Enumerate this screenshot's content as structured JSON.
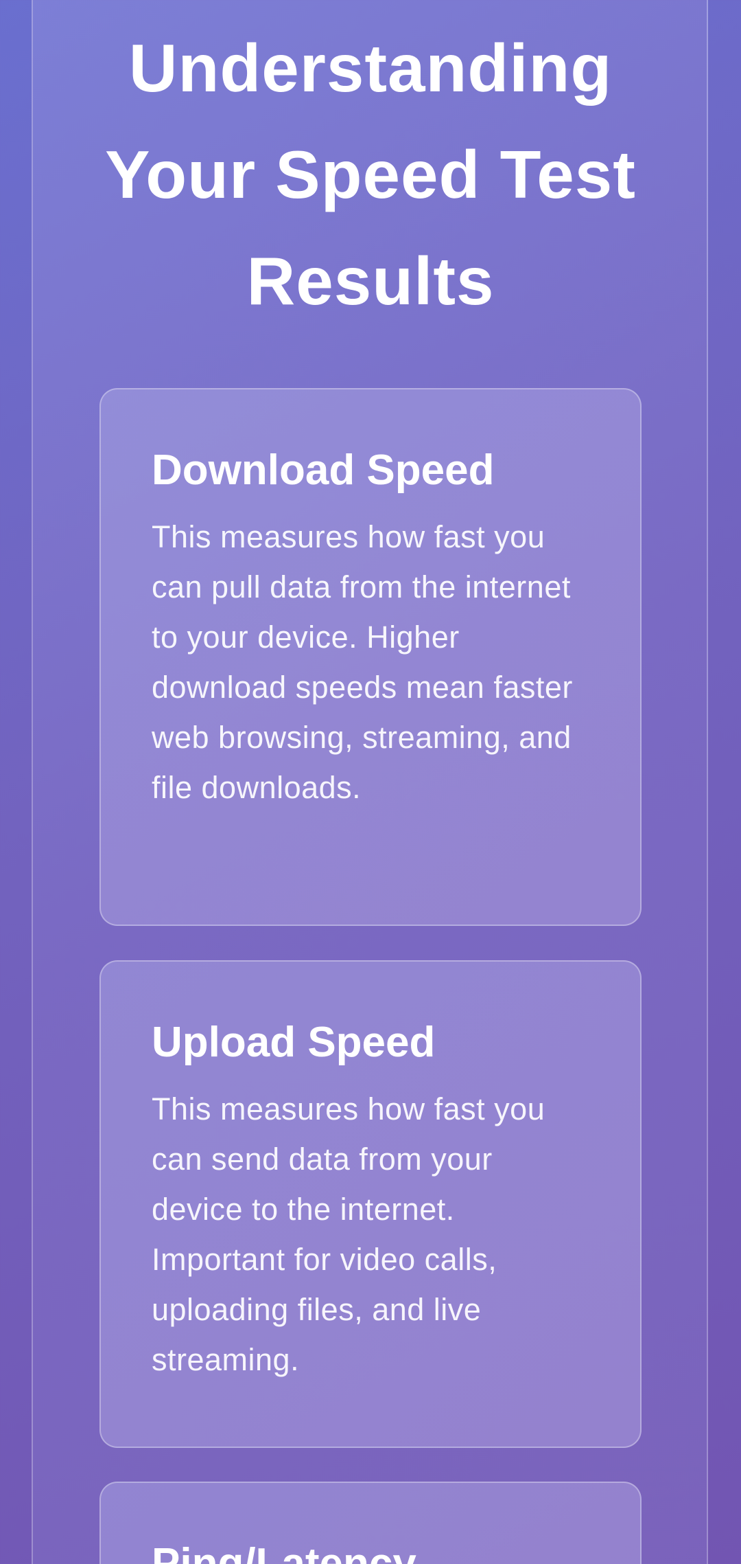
{
  "page": {
    "title": "Understanding Your Speed Test Results"
  },
  "cards": [
    {
      "title": "Download Speed",
      "text": "This measures how fast you can pull data from the internet to your device. Higher download speeds mean faster web browsing, streaming, and file downloads."
    },
    {
      "title": "Upload Speed",
      "text": "This measures how fast you can send data from your device to the internet. Important for video calls, uploading files, and live streaming."
    },
    {
      "title": "Ping/Latency"
    }
  ]
}
